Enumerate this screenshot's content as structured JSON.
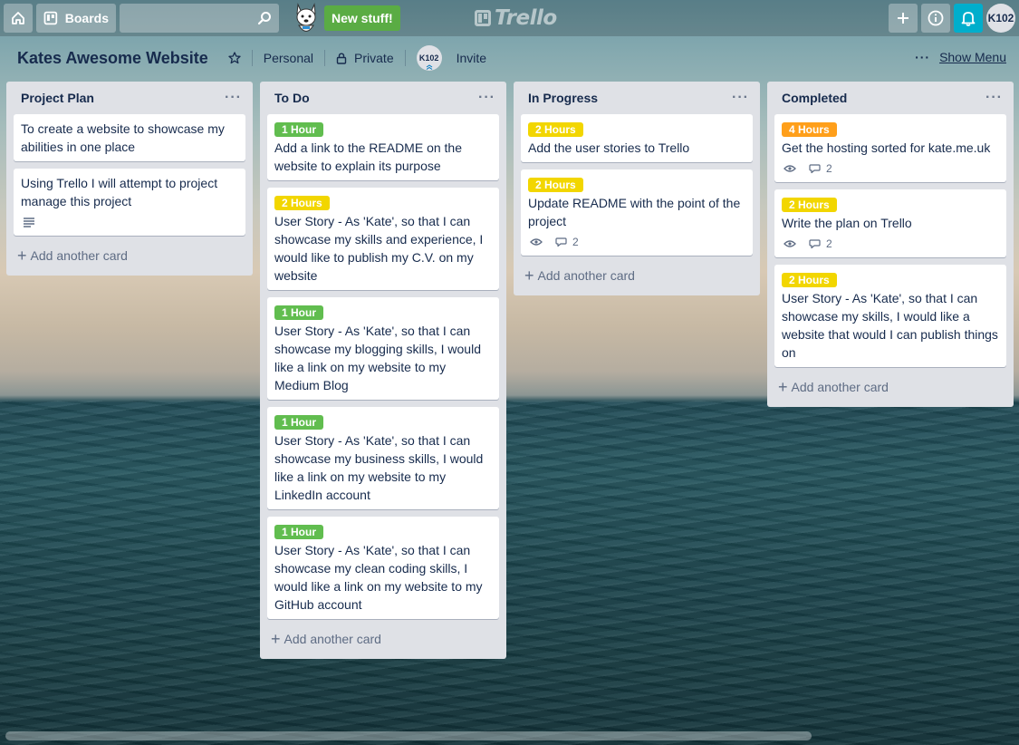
{
  "header": {
    "boards_label": "Boards",
    "new_stuff_label": "New stuff!",
    "logo_text": "Trello",
    "avatar_initials": "K102"
  },
  "board": {
    "title": "Kates Awesome Website",
    "team": "Personal",
    "visibility": "Private",
    "member_initials": "K102",
    "invite_label": "Invite",
    "show_menu_label": "Show Menu"
  },
  "add_card_label": "Add another card",
  "lists": [
    {
      "title": "Project Plan",
      "cards": [
        {
          "text": "To create a website to showcase my abilities in one place"
        },
        {
          "text": "Using Trello I will attempt to project manage this project",
          "has_description": true
        }
      ]
    },
    {
      "title": "To Do",
      "cards": [
        {
          "label": "1 Hour",
          "label_color": "#61bd4f",
          "text": "Add a link to the README on the website to explain its purpose"
        },
        {
          "label": "2 Hours",
          "label_color": "#f2d600",
          "text": "User Story - As 'Kate', so that I can showcase my skills and experience, I would like to publish my C.V. on my website"
        },
        {
          "label": "1 Hour",
          "label_color": "#61bd4f",
          "text": "User Story - As 'Kate', so that I can showcase my blogging skills, I would like a link on my website to my Medium Blog"
        },
        {
          "label": "1 Hour",
          "label_color": "#61bd4f",
          "text": "User Story - As 'Kate', so that I can showcase my business skills, I would like a link on my website to my LinkedIn account"
        },
        {
          "label": "1 Hour",
          "label_color": "#61bd4f",
          "text": "User Story - As 'Kate', so that I can showcase my clean coding skills, I would like a link on my website to my GitHub account"
        }
      ]
    },
    {
      "title": "In Progress",
      "cards": [
        {
          "label": "2 Hours",
          "label_color": "#f2d600",
          "text": "Add the user stories to Trello"
        },
        {
          "label": "2 Hours",
          "label_color": "#f2d600",
          "text": "Update README with the point of the project",
          "comments": "2"
        }
      ]
    },
    {
      "title": "Completed",
      "cards": [
        {
          "label": "4 Hours",
          "label_color": "#ff9f1a",
          "text": "Get the hosting sorted for kate.me.uk",
          "comments": "2"
        },
        {
          "label": "2 Hours",
          "label_color": "#f2d600",
          "text": "Write the plan on Trello",
          "comments": "2"
        },
        {
          "label": "2 Hours",
          "label_color": "#f2d600",
          "text": "User Story - As 'Kate', so that I can showcase my skills, I would like a website that would I can publish things on"
        }
      ]
    }
  ]
}
